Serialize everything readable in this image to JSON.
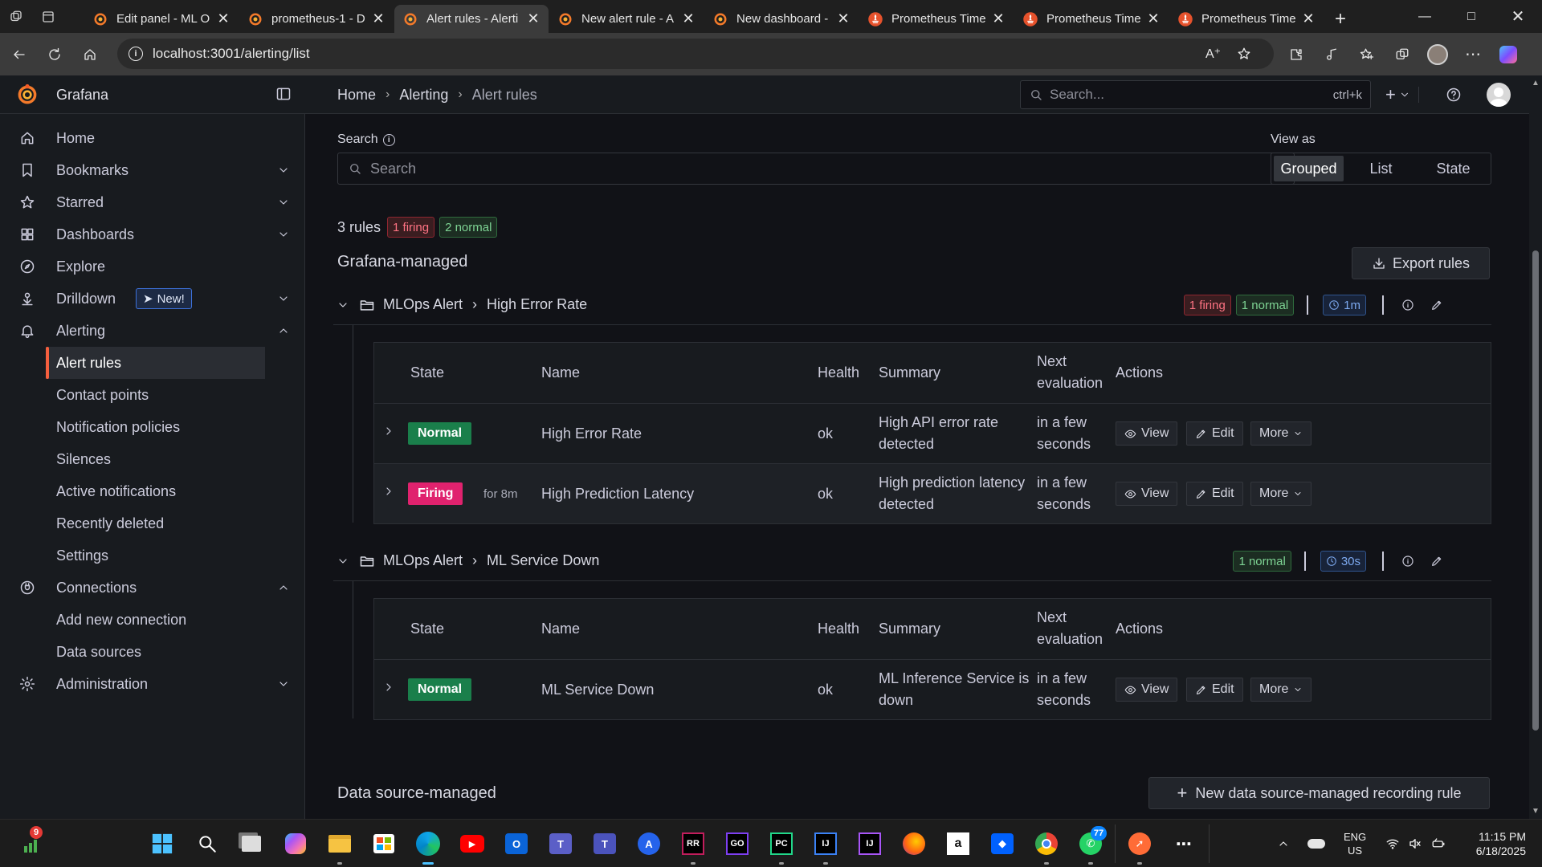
{
  "browser": {
    "tabs": [
      {
        "title": "Edit panel - ML O",
        "icon": "grafana-icon"
      },
      {
        "title": "prometheus-1 - D",
        "icon": "grafana-icon"
      },
      {
        "title": "Alert rules - Alerti",
        "icon": "grafana-icon",
        "active": true
      },
      {
        "title": "New alert rule - A",
        "icon": "grafana-icon"
      },
      {
        "title": "New dashboard -",
        "icon": "grafana-icon"
      },
      {
        "title": "Prometheus Time",
        "icon": "prometheus-icon"
      },
      {
        "title": "Prometheus Time",
        "icon": "prometheus-icon"
      },
      {
        "title": "Prometheus Time",
        "icon": "prometheus-icon"
      }
    ],
    "url": "localhost:3001/alerting/list"
  },
  "grafana": {
    "brand": "Grafana",
    "breadcrumb": [
      "Home",
      "Alerting",
      "Alert rules"
    ],
    "search_placeholder": "Search...",
    "search_shortcut": "ctrl+k",
    "add_symbol": "+"
  },
  "sidebar": {
    "items": [
      {
        "label": "Home",
        "icon": "home-icon"
      },
      {
        "label": "Bookmarks",
        "icon": "bookmark-icon",
        "chevron": "down"
      },
      {
        "label": "Starred",
        "icon": "star-icon",
        "chevron": "down"
      },
      {
        "label": "Dashboards",
        "icon": "apps-icon",
        "chevron": "down"
      },
      {
        "label": "Explore",
        "icon": "compass-icon"
      },
      {
        "label": "Drilldown",
        "icon": "drilldown-icon",
        "chevron": "down",
        "badge": "New!"
      },
      {
        "label": "Alerting",
        "icon": "bell-icon",
        "chevron": "up"
      }
    ],
    "alerting_sub": [
      "Alert rules",
      "Contact points",
      "Notification policies",
      "Silences",
      "Active notifications",
      "Recently deleted",
      "Settings"
    ],
    "connections": {
      "label": "Connections",
      "icon": "plug-icon",
      "chevron": "up"
    },
    "connections_sub": [
      "Add new connection",
      "Data sources"
    ],
    "administration": {
      "label": "Administration",
      "icon": "cog-icon",
      "chevron": "down"
    }
  },
  "main": {
    "search_label": "Search",
    "search_placeholder": "Search",
    "view_as_label": "View as",
    "view_options": [
      "Grouped",
      "List",
      "State"
    ],
    "view_selected": "Grouped",
    "summary": {
      "rules": "3 rules",
      "firing": "1 firing",
      "normal": "2 normal"
    },
    "section_title": "Grafana-managed",
    "export_label": "Export rules",
    "columns": {
      "state": "State",
      "name": "Name",
      "health": "Health",
      "summary": "Summary",
      "next_eval": "Next evaluation",
      "actions": "Actions"
    },
    "action_labels": {
      "view": "View",
      "edit": "Edit",
      "more": "More"
    },
    "groups": [
      {
        "folder": "MLOps Alert",
        "name": "High Error Rate",
        "firing_badge": "1 firing",
        "normal_badge": "1 normal",
        "interval": "1m",
        "rules": [
          {
            "state": "Normal",
            "for": "",
            "name": "High Error Rate",
            "health": "ok",
            "summary": "High API error rate detected",
            "next_eval": "in a few seconds"
          },
          {
            "state": "Firing",
            "for": "for 8m",
            "name": "High Prediction Latency",
            "health": "ok",
            "summary": "High prediction latency detected",
            "next_eval": "in a few seconds"
          }
        ]
      },
      {
        "folder": "MLOps Alert",
        "name": "ML Service Down",
        "normal_badge": "1 normal",
        "interval": "30s",
        "rules": [
          {
            "state": "Normal",
            "for": "",
            "name": "ML Service Down",
            "health": "ok",
            "summary": "ML Inference Service is down",
            "next_eval": "in a few seconds"
          }
        ]
      }
    ],
    "ds_section_title": "Data source-managed",
    "new_ds_rule_label": "New data source-managed recording rule"
  },
  "taskbar": {
    "widget_badge": "9",
    "whatsapp_badge": "77",
    "lang": "ENG",
    "region": "US",
    "time": "11:15 PM",
    "date": "6/18/2025"
  },
  "colors": {
    "accent": "#f55f3e",
    "firing": "#e0226e",
    "normal": "#1a7f4b",
    "bg": "#111217",
    "panel": "#181b1f"
  }
}
